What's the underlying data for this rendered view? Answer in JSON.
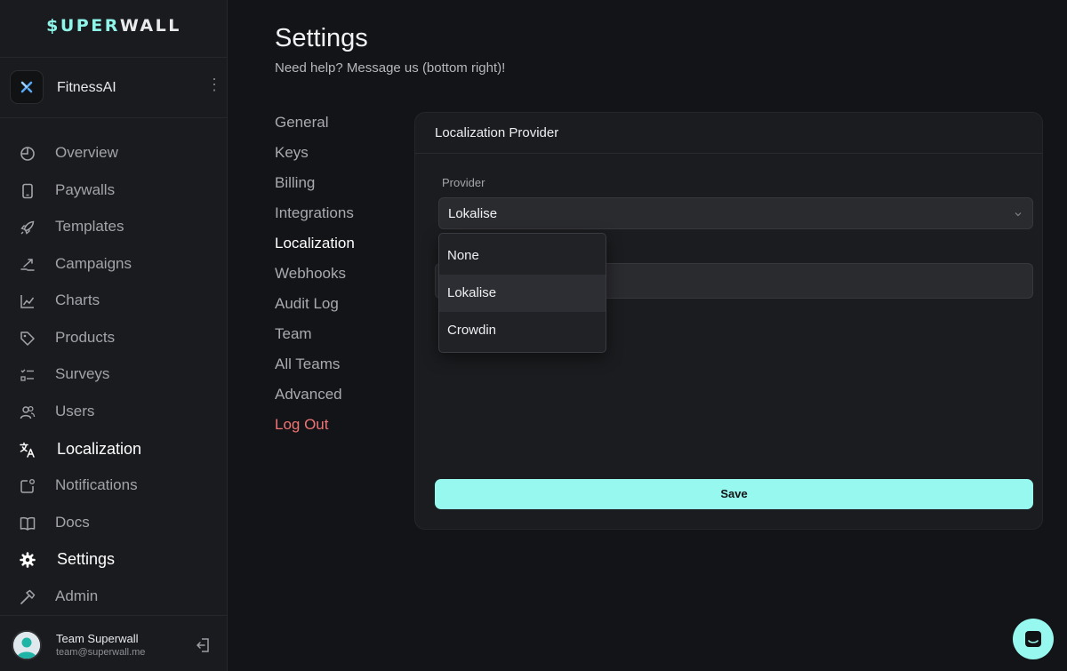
{
  "brand": {
    "logo_part1": "$UPER",
    "logo_part2": "WALL",
    "accent_color": "#96f8ee"
  },
  "app": {
    "name": "FitnessAI",
    "menu_glyph": "⋮"
  },
  "sidebar": {
    "items": [
      {
        "label": "Overview",
        "icon": "overview-icon"
      },
      {
        "label": "Paywalls",
        "icon": "phone-icon"
      },
      {
        "label": "Templates",
        "icon": "rocket-icon"
      },
      {
        "label": "Campaigns",
        "icon": "campaigns-icon"
      },
      {
        "label": "Charts",
        "icon": "chart-line-icon"
      },
      {
        "label": "Products",
        "icon": "tag-icon"
      },
      {
        "label": "Surveys",
        "icon": "checklist-icon"
      },
      {
        "label": "Users",
        "icon": "users-icon"
      },
      {
        "label": "Localization",
        "icon": "translate-icon",
        "active": true
      },
      {
        "label": "Notifications",
        "icon": "notification-icon"
      },
      {
        "label": "Docs",
        "icon": "book-icon"
      },
      {
        "label": "Settings",
        "icon": "gear-icon"
      },
      {
        "label": "Admin",
        "icon": "hammer-icon"
      }
    ]
  },
  "user": {
    "name": "Team Superwall",
    "email": "team@superwall.me"
  },
  "page": {
    "title": "Settings",
    "subtitle": "Need help? Message us (bottom right)!"
  },
  "settings_nav": [
    {
      "label": "General"
    },
    {
      "label": "Keys"
    },
    {
      "label": "Billing"
    },
    {
      "label": "Integrations"
    },
    {
      "label": "Localization",
      "active": true
    },
    {
      "label": "Webhooks"
    },
    {
      "label": "Audit Log"
    },
    {
      "label": "Team"
    },
    {
      "label": "All Teams"
    },
    {
      "label": "Advanced"
    },
    {
      "label": "Log Out",
      "danger": true
    }
  ],
  "card": {
    "title": "Localization Provider",
    "provider_label": "Provider",
    "provider_value": "Lokalise",
    "save_label": "Save"
  },
  "dropdown": {
    "options": [
      "None",
      "Lokalise",
      "Crowdin"
    ],
    "selected": "Lokalise"
  }
}
